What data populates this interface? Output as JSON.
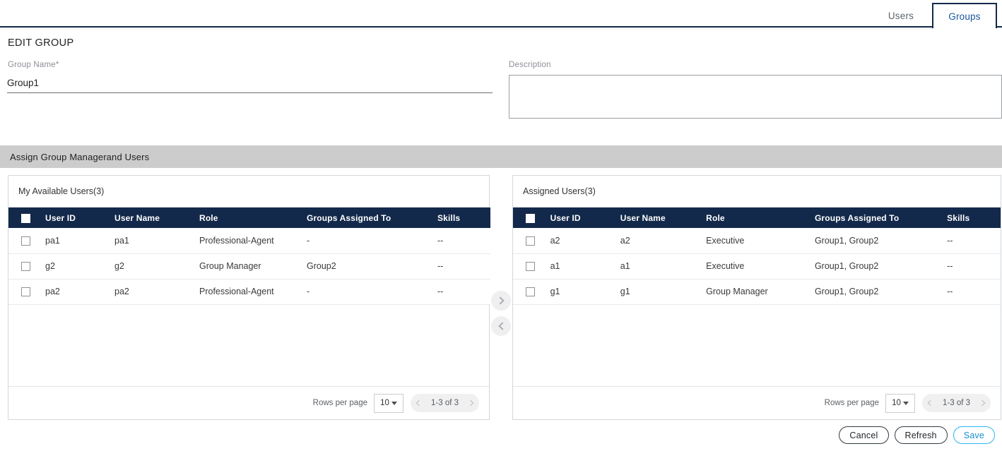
{
  "tabs": [
    {
      "label": "Users",
      "active": false
    },
    {
      "label": "Groups",
      "active": true
    }
  ],
  "header": {
    "title": "EDIT GROUP"
  },
  "form": {
    "group_name_label": "Group Name*",
    "group_name_value": "Group1",
    "group_name_placeholder": "",
    "description_label": "Description",
    "description_value": "",
    "description_placeholder": ""
  },
  "section": {
    "title": "Assign Group Managerand Users"
  },
  "columns": [
    "User ID",
    "User Name",
    "Role",
    "Groups Assigned To",
    "Skills"
  ],
  "available_panel": {
    "caption": "My Available Users(3)",
    "rows": [
      {
        "user_id": "pa1",
        "user_name": "pa1",
        "role": "Professional-Agent",
        "groups": "-",
        "skills": "--"
      },
      {
        "user_id": "g2",
        "user_name": "g2",
        "role": "Group Manager",
        "groups": "Group2",
        "skills": "--"
      },
      {
        "user_id": "pa2",
        "user_name": "pa2",
        "role": "Professional-Agent",
        "groups": "-",
        "skills": "--"
      }
    ],
    "footer": {
      "rows_per_page_label": "Rows per page",
      "rows_per_page_value": "10",
      "range_label": "1-3 of 3"
    }
  },
  "assigned_panel": {
    "caption": "Assigned Users(3)",
    "rows": [
      {
        "user_id": "a2",
        "user_name": "a2",
        "role": "Executive",
        "groups": "Group1, Group2",
        "skills": "--"
      },
      {
        "user_id": "a1",
        "user_name": "a1",
        "role": "Executive",
        "groups": "Group1, Group2",
        "skills": "--"
      },
      {
        "user_id": "g1",
        "user_name": "g1",
        "role": "Group Manager",
        "groups": "Group1, Group2",
        "skills": "--"
      }
    ],
    "footer": {
      "rows_per_page_label": "Rows per page",
      "rows_per_page_value": "10",
      "range_label": "1-3 of 3"
    }
  },
  "transfer": {
    "move_right_icon": "chevron-right-icon",
    "move_left_icon": "chevron-left-icon"
  },
  "actions": {
    "cancel": "Cancel",
    "refresh": "Refresh",
    "save": "Save"
  },
  "colors": {
    "header_navy": "#13294b",
    "tab_active_text": "#17569b",
    "section_gray": "#cccccc",
    "save_accent": "#29b6f0"
  }
}
